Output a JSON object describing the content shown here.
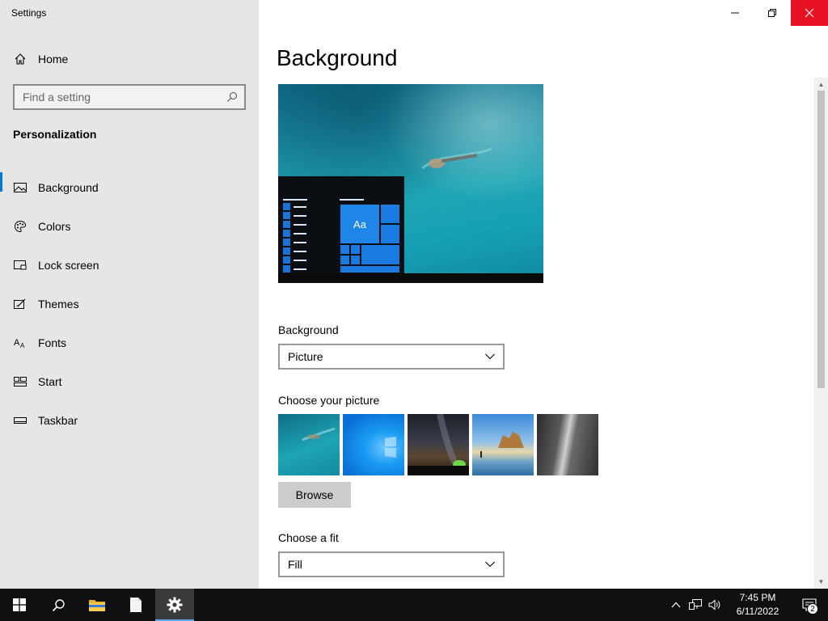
{
  "window": {
    "title": "Settings"
  },
  "sidebar": {
    "home_label": "Home",
    "search": {
      "placeholder": "Find a setting",
      "value": ""
    },
    "section_title": "Personalization",
    "items": [
      {
        "label": "Background",
        "icon": "picture-icon",
        "active": true
      },
      {
        "label": "Colors",
        "icon": "palette-icon",
        "active": false
      },
      {
        "label": "Lock screen",
        "icon": "lock-screen-icon",
        "active": false
      },
      {
        "label": "Themes",
        "icon": "themes-icon",
        "active": false
      },
      {
        "label": "Fonts",
        "icon": "fonts-icon",
        "active": false
      },
      {
        "label": "Start",
        "icon": "start-icon",
        "active": false
      },
      {
        "label": "Taskbar",
        "icon": "taskbar-icon",
        "active": false
      }
    ]
  },
  "main": {
    "title": "Background",
    "preview": {
      "tile_label": "Aa"
    },
    "background_label": "Background",
    "background_value": "Picture",
    "choose_picture_label": "Choose your picture",
    "pictures": [
      "underwater-swimmer",
      "windows-blue",
      "night-sky",
      "beach-rocks",
      "waterfall-cliff"
    ],
    "browse_label": "Browse",
    "fit_label": "Choose a fit",
    "fit_value": "Fill"
  },
  "taskbar": {
    "time": "7:45 PM",
    "date": "6/11/2022",
    "notification_count": "2"
  },
  "colors": {
    "accent": "#0078d7",
    "close": "#e81123",
    "sidebar_bg": "#e6e6e6"
  }
}
